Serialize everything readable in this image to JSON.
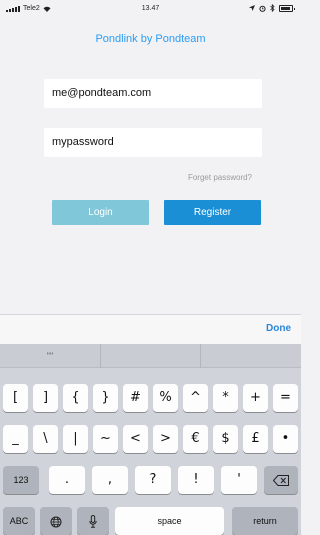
{
  "status_bar": {
    "carrier": "Tele2",
    "time": "13.47"
  },
  "app": {
    "title": "Pondlink by Pondteam"
  },
  "form": {
    "email_value": "me@pondteam.com",
    "password_value": "mypassword",
    "forgot_label": "Forget password?",
    "login_label": "Login",
    "register_label": "Register"
  },
  "toolbar": {
    "done_label": "Done"
  },
  "keyboard": {
    "suggestions": [
      "\"\"",
      "",
      ""
    ],
    "row1": [
      "[",
      "]",
      "{",
      "}",
      "#",
      "%",
      "^",
      "*",
      "+",
      "="
    ],
    "row2": [
      "_",
      "\\",
      "|",
      "~",
      "<",
      ">",
      "€",
      "$",
      "£",
      "•"
    ],
    "row3_mode": "123",
    "row3": [
      ".",
      ",",
      "?",
      "!",
      "'"
    ],
    "row4_abc": "ABC",
    "space_label": "space",
    "return_label": "return"
  },
  "colors": {
    "accent": "#2a9df4",
    "login_button": "#80c7d9",
    "register_button": "#1a8fd6",
    "background": "#f2f2f4"
  },
  "icons": [
    "wifi-icon",
    "location-icon",
    "alarm-icon",
    "bluetooth-icon",
    "battery-icon",
    "globe-icon",
    "microphone-icon",
    "backspace-icon"
  ]
}
